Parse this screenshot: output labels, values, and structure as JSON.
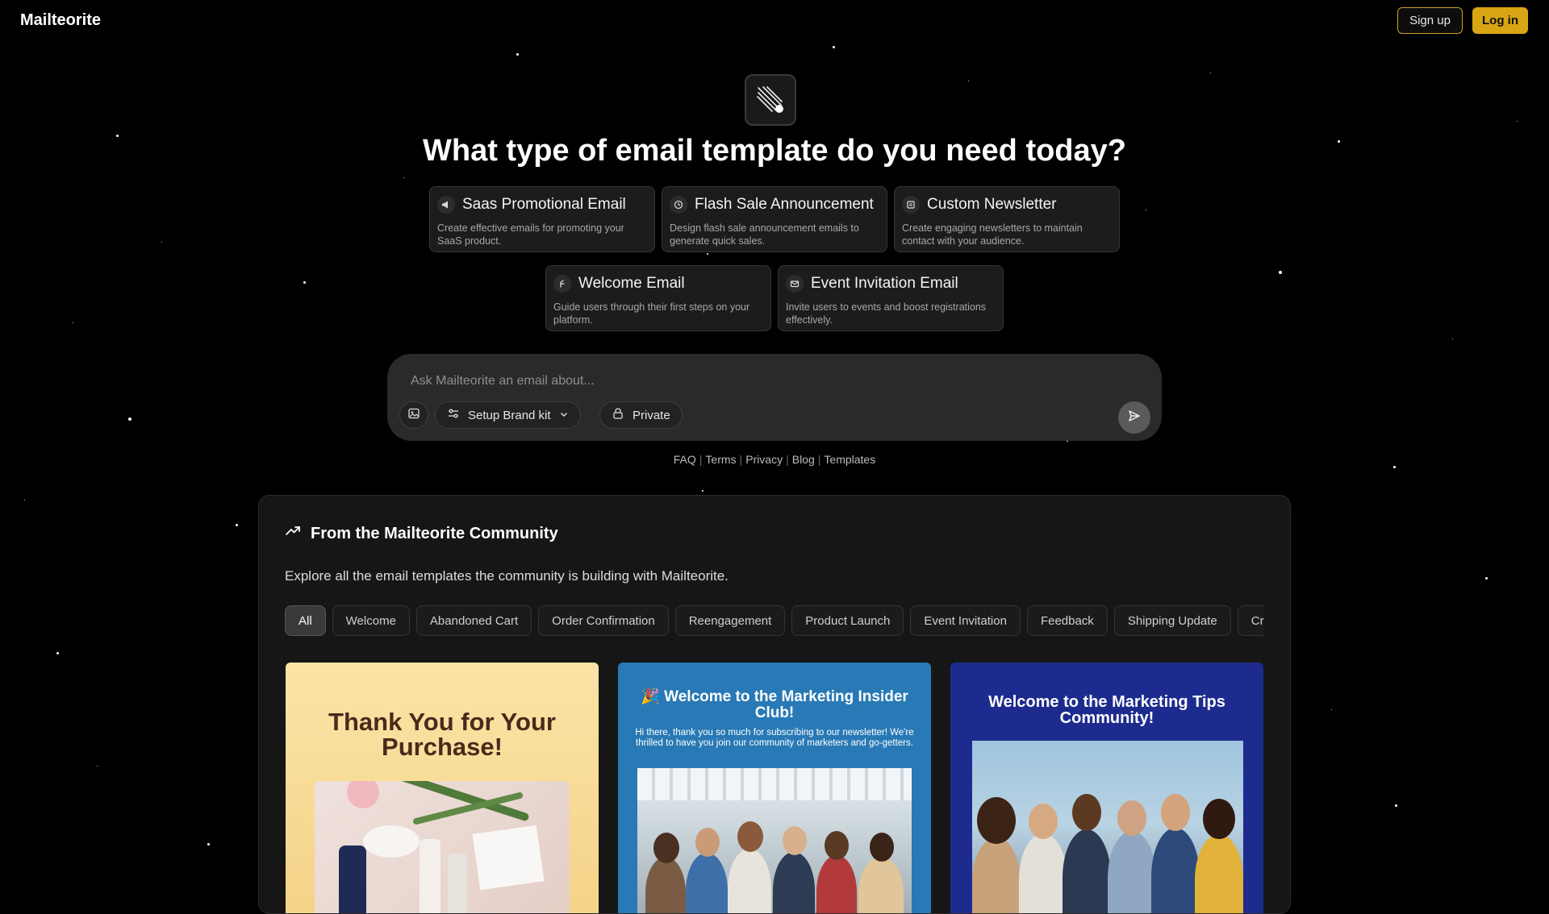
{
  "header": {
    "brand": "Mailteorite",
    "signup_label": "Sign up",
    "login_label": "Log in"
  },
  "hero": {
    "title": "What type of email template do you need today?"
  },
  "template_cards": [
    {
      "icon": "megaphone-icon",
      "title": "Saas Promotional Email",
      "description": "Create effective emails for promoting your SaaS product."
    },
    {
      "icon": "clock-icon",
      "title": "Flash Sale Announcement",
      "description": "Design flash sale announcement emails to generate quick sales."
    },
    {
      "icon": "newspaper-icon",
      "title": "Custom Newsletter",
      "description": "Create engaging newsletters to maintain contact with your audience."
    },
    {
      "icon": "hand-wave-icon",
      "title": "Welcome Email",
      "description": "Guide users through their first steps on your platform."
    },
    {
      "icon": "envelope-icon",
      "title": "Event Invitation Email",
      "description": "Invite users to events and boost registrations effectively."
    }
  ],
  "prompt": {
    "placeholder": "Ask Mailteorite an email about...",
    "brand_kit_label": "Setup Brand kit",
    "private_label": "Private"
  },
  "footer_links": [
    "FAQ",
    "Terms",
    "Privacy",
    "Blog",
    "Templates"
  ],
  "community": {
    "title": "From the Mailteorite Community",
    "subtitle": "Explore all the email templates the community is building with Mailteorite.",
    "filters": [
      "All",
      "Welcome",
      "Abandoned Cart",
      "Order Confirmation",
      "Reengagement",
      "Product Launch",
      "Event Invitation",
      "Feedback",
      "Shipping Update",
      "Cr"
    ],
    "active_filter": "All",
    "templates": [
      {
        "title": "Thank You for Your Purchase!"
      },
      {
        "title": "🎉 Welcome to the Marketing Insider Club!",
        "body": "Hi there, thank you so much for subscribing to our newsletter! We're thrilled to have you join our community of marketers and go-getters."
      },
      {
        "title": "Welcome to the Marketing Tips Community!"
      }
    ]
  },
  "colors": {
    "accent": "#d9a514",
    "background": "#000000",
    "panel": "#161616"
  }
}
